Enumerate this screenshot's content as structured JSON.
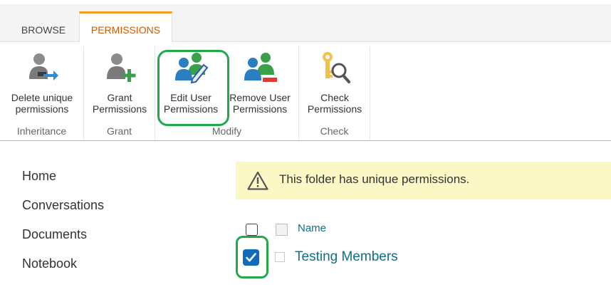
{
  "tabs": [
    {
      "label": "BROWSE",
      "active": false
    },
    {
      "label": "PERMISSIONS",
      "active": true
    }
  ],
  "ribbon": {
    "groups": [
      {
        "label": "Inheritance",
        "buttons": [
          {
            "line1": "Delete unique",
            "line2": "permissions",
            "icon": "delete-inheritance-icon"
          }
        ]
      },
      {
        "label": "Grant",
        "buttons": [
          {
            "line1": "Grant",
            "line2": "Permissions",
            "icon": "grant-permissions-icon"
          }
        ]
      },
      {
        "label": "Modify",
        "buttons": [
          {
            "line1": "Edit User",
            "line2": "Permissions",
            "icon": "edit-user-permissions-icon"
          },
          {
            "line1": "Remove User",
            "line2": "Permissions",
            "icon": "remove-user-permissions-icon"
          }
        ]
      },
      {
        "label": "Check",
        "buttons": [
          {
            "line1": "Check",
            "line2": "Permissions",
            "icon": "check-permissions-icon"
          }
        ]
      }
    ]
  },
  "nav": {
    "items": [
      "Home",
      "Conversations",
      "Documents",
      "Notebook"
    ]
  },
  "notice": {
    "text": "This folder has unique permissions.",
    "icon": "warning-icon"
  },
  "list": {
    "column_name": "Name",
    "rows": [
      {
        "name": "Testing Members",
        "checked": true
      }
    ]
  },
  "colors": {
    "accent": "#d05a00",
    "tab_border": "#f59b22",
    "highlight": "#22a84a",
    "link": "#0f6e8c",
    "notice_bg": "#fcf8c6",
    "checkbox_checked": "#0f6cbd"
  }
}
